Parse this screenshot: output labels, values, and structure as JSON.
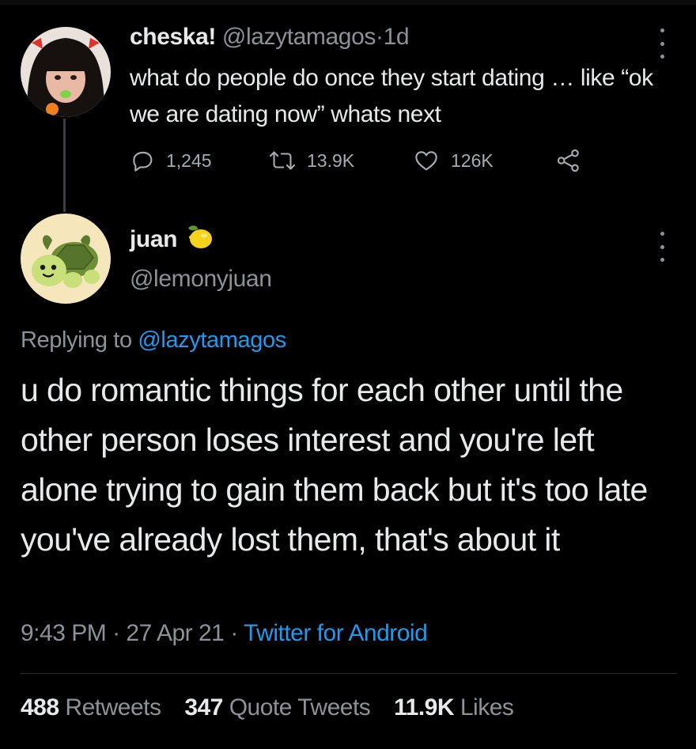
{
  "parent_tweet": {
    "display_name": "cheska!",
    "handle": "@lazytamagos",
    "separator": "·",
    "age": "1d",
    "text": "what do people do once they start dating … like “ok we are dating now” whats next",
    "replies": "1,245",
    "retweets": "13.9K",
    "likes": "126K",
    "icons": {
      "reply": "reply-icon",
      "retweet": "retweet-icon",
      "like": "heart-icon",
      "share": "share-icon",
      "more": "more-icon"
    }
  },
  "reply_tweet": {
    "display_name": "juan",
    "name_emoji": "lemon-icon",
    "handle": "@lemonyjuan",
    "replying_prefix": "Replying to",
    "replying_handle": "@lazytamagos",
    "text": "u do romantic things for each other until the other person loses interest and you're left alone trying to gain them back but it's too late you've already lost them, that's about it",
    "time": "9:43 PM",
    "date": "27 Apr 21",
    "separator": "·",
    "source": "Twitter for Android",
    "stats": {
      "retweets_count": "488",
      "retweets_label": "Retweets",
      "quotes_count": "347",
      "quotes_label": "Quote Tweets",
      "likes_count": "11.9K",
      "likes_label": "Likes"
    }
  },
  "colors": {
    "background": "#000000",
    "text": "#e7e9ea",
    "muted": "#8b9299",
    "link": "#1d9bf0"
  }
}
